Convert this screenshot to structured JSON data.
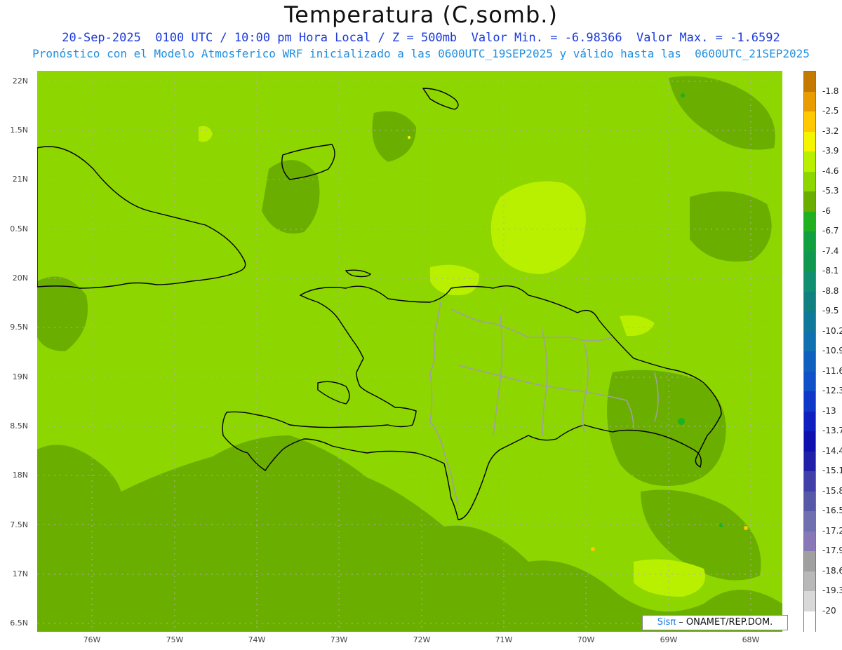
{
  "title": "Temperatura (C,somb.)",
  "subtitle_line1": "20-Sep-2025  0100 UTC / 10:00 pm Hora Local / Z = 500mb  Valor Min. = -6.98366  Valor Max. = -1.6592",
  "subtitle_line2": "Pronóstico con el Modelo Atmosferico WRF inicializado a las 0600UTC_19SEP2025 y válido hasta las  0600UTC_21SEP2025",
  "lat_labels": [
    "22N",
    "1.5N",
    "21N",
    "0.5N",
    "20N",
    "9.5N",
    "19N",
    "8.5N",
    "18N",
    "7.5N",
    "17N",
    "6.5N"
  ],
  "lon_labels": [
    "76W",
    "75W",
    "74W",
    "73W",
    "72W",
    "71W",
    "70W",
    "69W",
    "68W"
  ],
  "colorbar": {
    "labels": [
      "-1.8",
      "-2.5",
      "-3.2",
      "-3.9",
      "-4.6",
      "-5.3",
      "-6",
      "-6.7",
      "-7.4",
      "-8.1",
      "-8.8",
      "-9.5",
      "-10.2",
      "-10.9",
      "-11.6",
      "-12.3",
      "-13",
      "-13.7",
      "-14.4",
      "-15.1",
      "-15.8",
      "-16.5",
      "-17.2",
      "-17.9",
      "-18.6",
      "-19.3",
      "-20"
    ],
    "colors": [
      "#c47a00",
      "#e89c00",
      "#ffc800",
      "#f5f500",
      "#b8f000",
      "#8ed600",
      "#6aae00",
      "#20b020",
      "#10a040",
      "#109850",
      "#109070",
      "#108080",
      "#107898",
      "#1070b0",
      "#1060c0",
      "#1050c8",
      "#1038c8",
      "#1020c0",
      "#1010b0",
      "#2020a8",
      "#4040a8",
      "#5858a8",
      "#7070b0",
      "#8878b8",
      "#a0a0a0",
      "#b8b8b8",
      "#d8d8d8",
      "#ffffff"
    ]
  },
  "field_colors": {
    "base": "#8ed600",
    "cool": "#6aae00",
    "warm": "#b8f000",
    "coast": "#000000",
    "border": "#a0a0a0"
  },
  "credit": {
    "part1": "Sis",
    "part2": "π",
    "part3": " – ONAMET/REP.DOM."
  }
}
